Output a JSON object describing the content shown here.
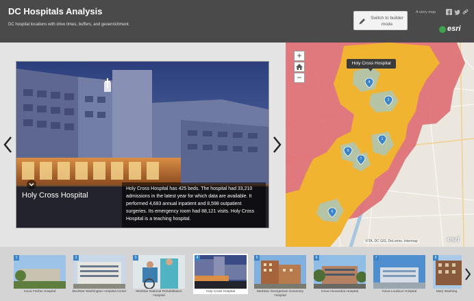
{
  "header": {
    "title": "DC Hospitals Analysis",
    "subtitle": "DC hospital locations with drive times, buffers, and geoenrichment.",
    "builder_button": "Switch to builder mode",
    "story_label": "A story map",
    "share_icons": [
      "facebook-icon",
      "twitter-icon",
      "link-icon"
    ],
    "brand": "esri"
  },
  "slide": {
    "title": "Holy Cross Hospital",
    "description": "Holy Cross Hospital has 425 beds. The hospital had 33,210 admissions in the latest year for which data are available. It performed 4,683 annual inpatient and 8,598 outpatient surgeries. Its emergency room had 88,121 visits. Holy Cross Hospital is a teaching hospital."
  },
  "map": {
    "popup": "Holy Cross Hospital",
    "zoom_in": "+",
    "home_icon": "home-icon",
    "zoom_out": "−",
    "attribution": "VITA, DC GIS, DeLorme, Intermap",
    "brand": "esri",
    "markers": [
      "1",
      "2",
      "3",
      "4",
      "5",
      "6",
      "7",
      "8"
    ]
  },
  "thumbnails": [
    {
      "num": "1",
      "label": "Inova Fairfax Hospital"
    },
    {
      "num": "2",
      "label": "MedStar Washington Hospital Center"
    },
    {
      "num": "3",
      "label": "MedStar National Rehabilitation Hospital"
    },
    {
      "num": "4",
      "label": "Holy Cross Hospital"
    },
    {
      "num": "5",
      "label": "MedStar Georgetown University Hospital"
    },
    {
      "num": "6",
      "label": "Inova Alexandria Hospital"
    },
    {
      "num": "7",
      "label": "Inova Loudoun Hospital"
    },
    {
      "num": "8",
      "label": "Mary Washing"
    }
  ],
  "colors": {
    "header_bg": "#4a4a4a",
    "drive_time_zone": "#f1b431",
    "buffer_zone": "#df6d72",
    "core_zone": "#b5c4a5",
    "marker": "#3b84c6"
  }
}
